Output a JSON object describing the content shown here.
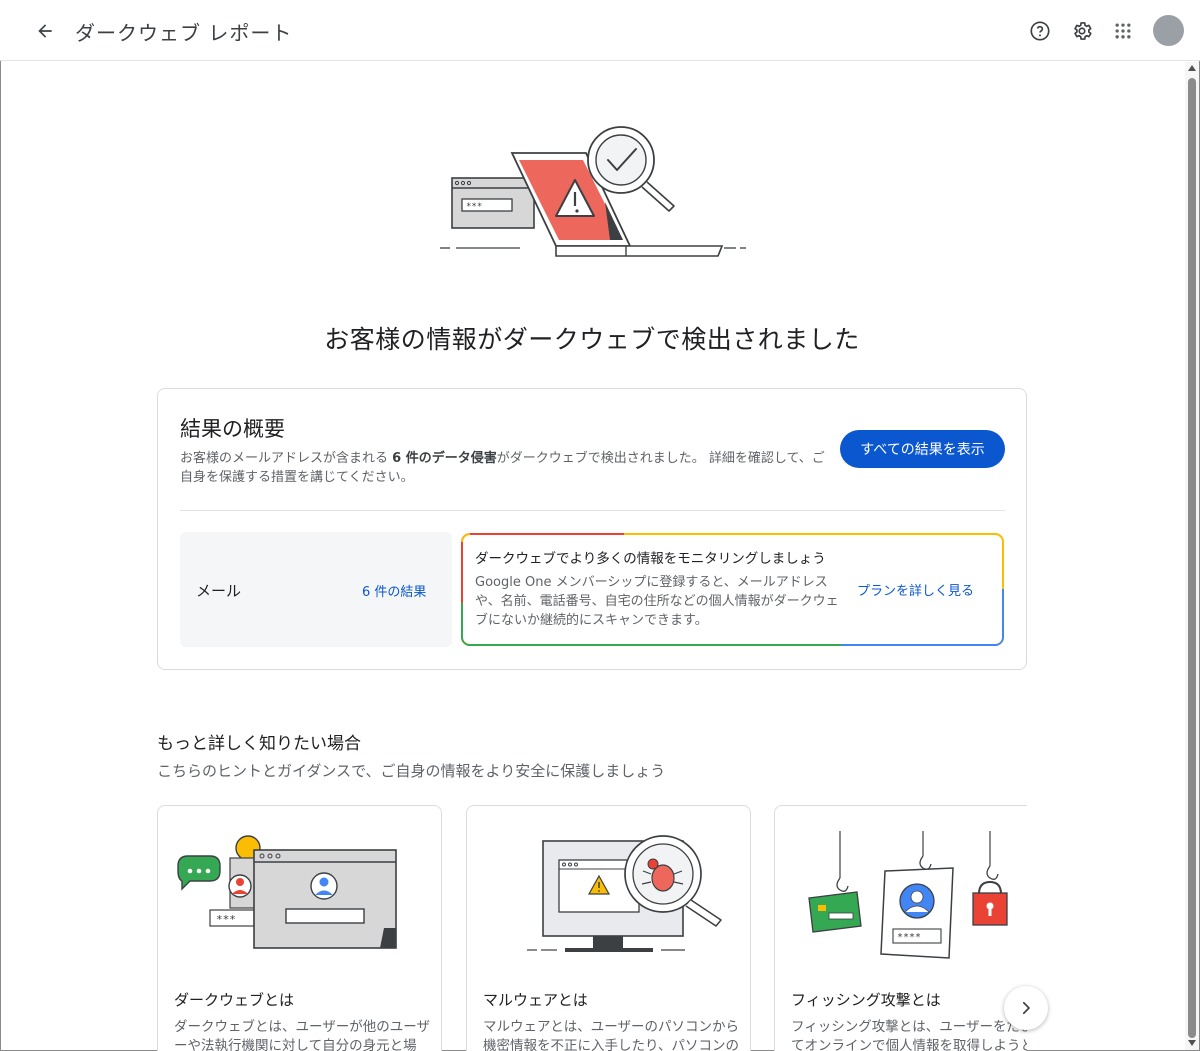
{
  "header": {
    "title": "ダークウェブ レポート",
    "back_icon": "arrow-back-icon",
    "icons": [
      "help-icon",
      "settings-icon",
      "apps-icon"
    ]
  },
  "hero": {
    "title": "お客様の情報がダークウェブで検出されました",
    "illustration_password": "***"
  },
  "summary": {
    "title": "結果の概要",
    "desc_prefix": "お客様のメールアドレスが含まれる ",
    "desc_bold": "6 件のデータ侵害",
    "desc_suffix": "がダークウェブで検出されました。 詳細を確認して、ご自身を保護する措置を講じてください。",
    "view_all_button": "すべての結果を表示",
    "email_label": "メール",
    "email_results_link": "6 件の結果"
  },
  "monitoring": {
    "title": "ダークウェブでより多くの情報をモニタリングしましょう",
    "desc": "Google One メンバーシップに登録すると、メールアドレスや、名前、電話番号、自宅の住所などの個人情報がダークウェブにないか継続的にスキャンできます。",
    "link": "プランを詳しく見る"
  },
  "learn_more": {
    "title": "もっと詳しく知りたい場合",
    "subtitle": "こちらのヒントとガイダンスで、ご自身の情報をより安全に保護しましょう",
    "cards": [
      {
        "title": "ダークウェブとは",
        "desc": "ダークウェブとは、ユーザーが他のユーザーや法執行機関に対して自分の身元と場所",
        "illustration_password": "***"
      },
      {
        "title": "マルウェアとは",
        "desc": "マルウェアとは、ユーザーのパソコンから機密情報を不正に入手したり、パソコンの動"
      },
      {
        "title": "フィッシング攻撃とは",
        "desc": "フィッシング攻撃とは、ユーザーをだましてオンラインで個人情報を取得しようとす",
        "illustration_password": "****"
      }
    ]
  },
  "colors": {
    "primary": "#0b57d0",
    "alert_red": "#ee675c",
    "google_red": "#ea4335",
    "google_yellow": "#fbbc04",
    "google_green": "#34a853",
    "google_blue": "#4285f4"
  }
}
